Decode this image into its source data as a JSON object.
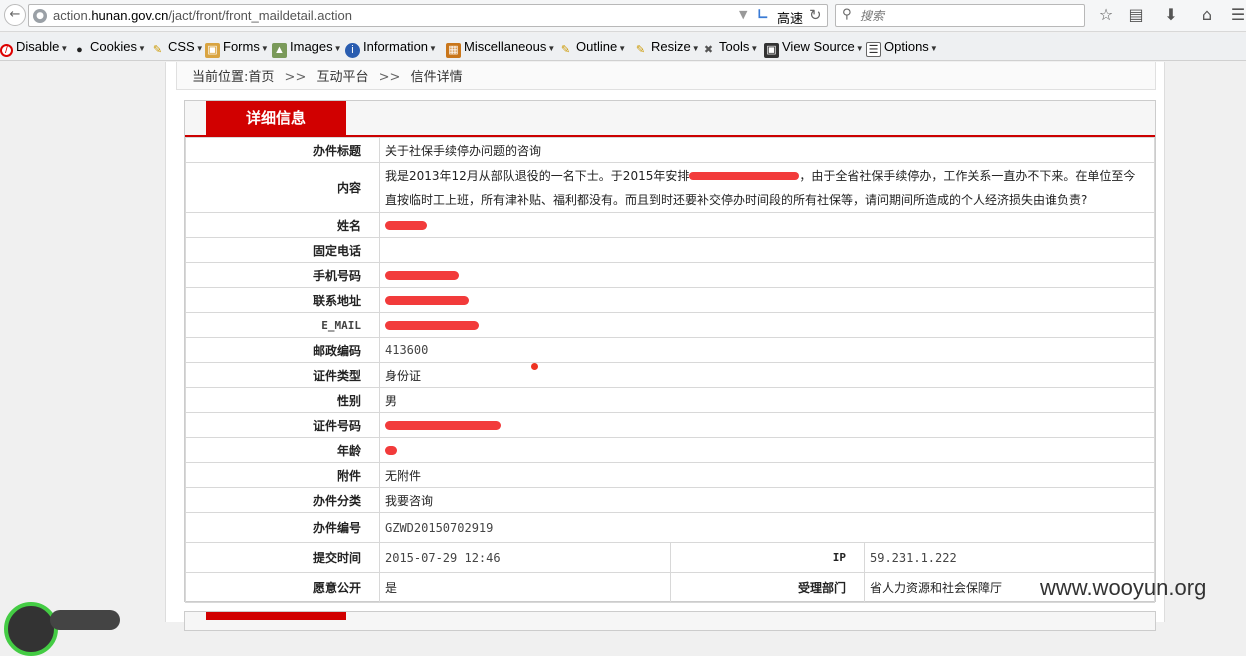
{
  "browser": {
    "url_prefix": "action.",
    "url_domain": "hunan.gov.cn",
    "url_path": "/jact/front/front_maildetail.action",
    "speed_label": "高速",
    "search_placeholder": "搜索"
  },
  "webdev_toolbar": [
    {
      "label": "Disable",
      "icon": "disable-icon"
    },
    {
      "label": "Cookies",
      "icon": "cookies-icon"
    },
    {
      "label": "CSS",
      "icon": "css-icon"
    },
    {
      "label": "Forms",
      "icon": "forms-icon"
    },
    {
      "label": "Images",
      "icon": "images-icon"
    },
    {
      "label": "Information",
      "icon": "information-icon"
    },
    {
      "label": "Miscellaneous",
      "icon": "miscellaneous-icon"
    },
    {
      "label": "Outline",
      "icon": "outline-icon"
    },
    {
      "label": "Resize",
      "icon": "resize-icon"
    },
    {
      "label": "Tools",
      "icon": "tools-icon"
    },
    {
      "label": "View Source",
      "icon": "view-source-icon"
    },
    {
      "label": "Options",
      "icon": "options-icon"
    }
  ],
  "breadcrumb": {
    "prefix": "当前位置:",
    "home": "首页",
    "sep1": ">>",
    "section": "互动平台",
    "sep2": ">>",
    "current": "信件详情"
  },
  "panel": {
    "title": "详细信息"
  },
  "detail": {
    "subject_label": "办件标题",
    "subject_value": "关于社保手续停办问题的咨询",
    "content_label": "内容",
    "content_part1": "我是2013年12月从部队退役的一名下士。于2015年安排",
    "content_part2": "，由于全省社保手续停办，工作关系一直办不下来。在单位至今直按临时工上班，所有津补贴、福利都没有。而且到时还要补交停办时间段的所有社保等，请问期间所造成的个人经济损失由谁负责?",
    "name_label": "姓名",
    "phone_label": "固定电话",
    "mobile_label": "手机号码",
    "address_label": "联系地址",
    "email_label": "E_MAIL",
    "postcode_label": "邮政编码",
    "postcode_value": "413600",
    "idtype_label": "证件类型",
    "idtype_value": "身份证",
    "gender_label": "性别",
    "gender_value": "男",
    "idnum_label": "证件号码",
    "age_label": "年龄",
    "attachment_label": "附件",
    "attachment_value": "无附件",
    "category_label": "办件分类",
    "category_value": "我要咨询",
    "number_label": "办件编号",
    "number_value": "GZWD20150702919",
    "submit_time_label": "提交时间",
    "submit_time_value": "2015-07-29 12:46",
    "ip_label": "IP",
    "ip_value": "59.231.1.222",
    "public_label": "愿意公开",
    "public_value": "是",
    "dept_label": "受理部门",
    "dept_value": "省人力资源和社会保障厅"
  },
  "watermark": "www.wooyun.org",
  "colors": {
    "accent_red": "#d10000",
    "redaction": "#f23b3b"
  }
}
